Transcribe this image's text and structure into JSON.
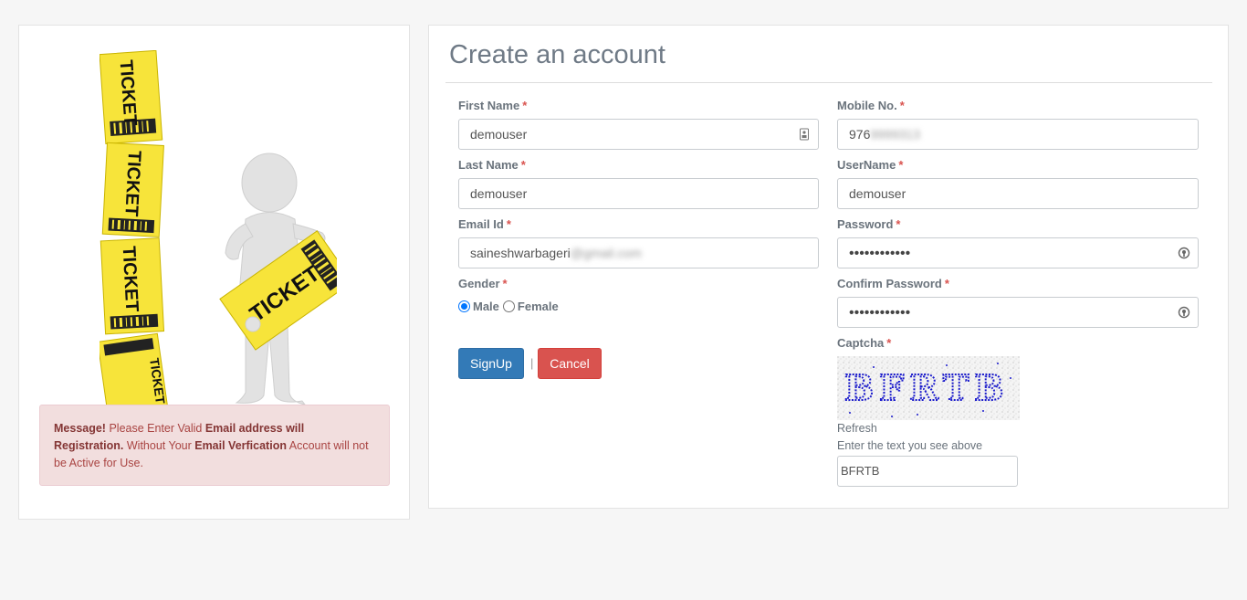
{
  "illustration": {
    "ticket_text": "TICKET"
  },
  "alert": {
    "lead": "Message!",
    "text1": " Please Enter Valid ",
    "strong1": "Email address will Registration.",
    "text2": " Without Your ",
    "strong2": "Email Verfication",
    "text3": " Account will not be Active for Use."
  },
  "form": {
    "title": "Create an account",
    "required_mark": "*",
    "first_name": {
      "label": "First Name",
      "value": "demouser"
    },
    "last_name": {
      "label": "Last Name",
      "value": "demouser"
    },
    "email": {
      "label": "Email Id",
      "value_visible": "saineshwarbageri",
      "value_blurred": "@gmail.com"
    },
    "gender": {
      "label": "Gender",
      "options": [
        "Male",
        "Female"
      ],
      "selected": "Male"
    },
    "mobile": {
      "label": "Mobile No.",
      "value_visible": "976",
      "value_blurred": "9999313"
    },
    "username": {
      "label": "UserName",
      "value": "demouser"
    },
    "password": {
      "label": "Password",
      "value": "••••••••••••"
    },
    "confirm_password": {
      "label": "Confirm Password",
      "value": "••••••••••••"
    },
    "captcha": {
      "label": "Captcha",
      "image_text": "BFRTB",
      "refresh_label": "Refresh",
      "hint": "Enter the text you see above",
      "value": "BFRTB"
    },
    "buttons": {
      "signup": "SignUp",
      "separator": "|",
      "cancel": "Cancel"
    }
  },
  "colors": {
    "primary": "#337ab7",
    "danger": "#d9534f",
    "alert_bg": "#f2dede",
    "ticket_yellow": "#f7e43a"
  }
}
